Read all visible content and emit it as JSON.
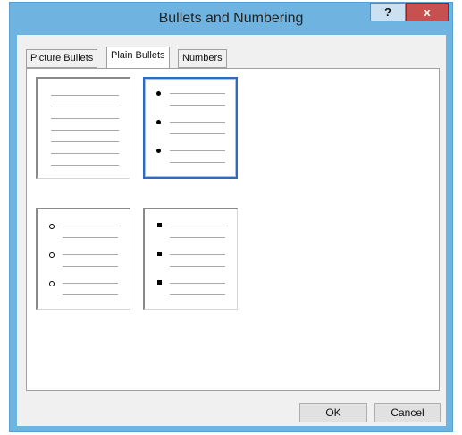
{
  "window": {
    "title": "Bullets and Numbering",
    "help_label": "?",
    "close_label": "x"
  },
  "tabs": [
    {
      "label": "Picture Bullets",
      "active": false
    },
    {
      "label": "Plain Bullets",
      "active": true
    },
    {
      "label": "Numbers",
      "active": false
    }
  ],
  "bullet_styles": [
    {
      "name": "None",
      "bullet": "none",
      "selected": false
    },
    {
      "name": "Disc",
      "bullet": "disc",
      "selected": true
    },
    {
      "name": "Circle",
      "bullet": "circle",
      "selected": false
    },
    {
      "name": "Square",
      "bullet": "square",
      "selected": false
    }
  ],
  "buttons": {
    "ok": "OK",
    "cancel": "Cancel"
  },
  "colors": {
    "title_bar": "#6fb4e1",
    "close_button": "#c75050",
    "selection_border": "#2d6bc1"
  }
}
